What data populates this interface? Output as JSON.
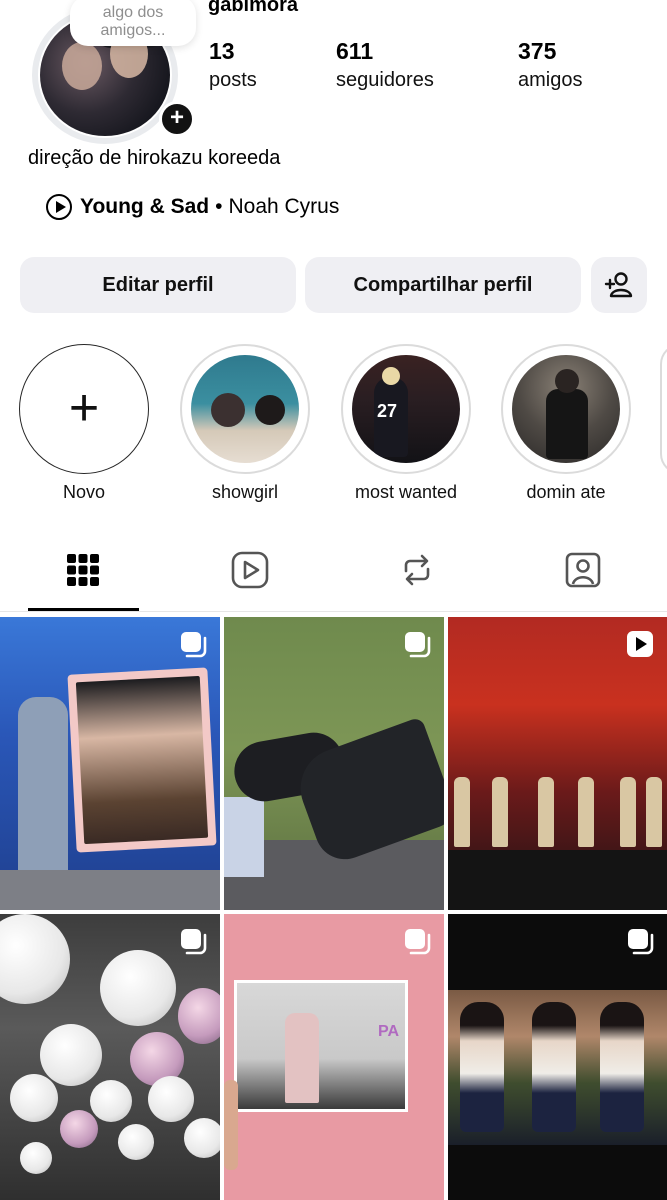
{
  "profile": {
    "username": "gabimora",
    "note": "algo dos amigos...",
    "bio": "direção de hirokazu koreeda",
    "music": {
      "song": "Young & Sad",
      "separator": "•",
      "artist": "Noah Cyrus"
    }
  },
  "stats": {
    "posts": {
      "value": "13",
      "label": "posts"
    },
    "followers": {
      "value": "611",
      "label": "seguidores"
    },
    "friends": {
      "value": "375",
      "label": "amigos"
    }
  },
  "buttons": {
    "edit": "Editar perfil",
    "share": "Compartilhar perfil"
  },
  "highlights": [
    {
      "label": "Novo"
    },
    {
      "label": "showgirl"
    },
    {
      "label": "most wanted"
    },
    {
      "label": "domin ate"
    }
  ],
  "tabs": [
    "grid-icon",
    "reels-icon",
    "reposts-icon",
    "tagged-icon"
  ],
  "posts": [
    {
      "type": "carousel"
    },
    {
      "type": "carousel"
    },
    {
      "type": "reel"
    },
    {
      "type": "carousel"
    },
    {
      "type": "carousel"
    },
    {
      "type": "carousel"
    }
  ]
}
